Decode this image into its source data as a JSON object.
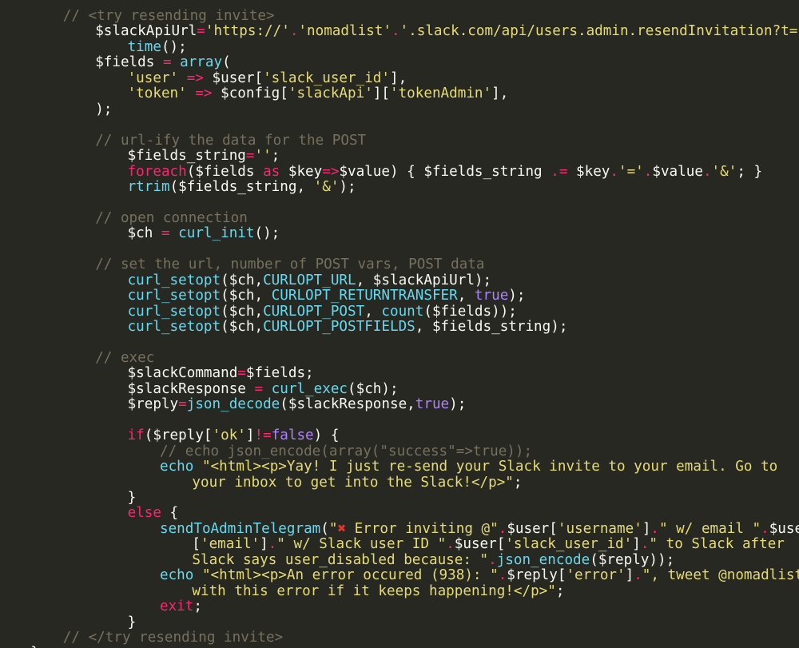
{
  "editor": {
    "theme": "dark",
    "colors": {
      "background": "#272822",
      "text": "#f8f8f2",
      "comment": "#75715e",
      "string": "#e6db74",
      "keyword": "#f92672",
      "function": "#66d9ef",
      "constant": "#ae81ff",
      "emoji": "#e8322d"
    },
    "lines": [
      {
        "indent": 2,
        "tokens": [
          [
            "c",
            "// <try resending invite>"
          ]
        ]
      },
      {
        "indent": 3,
        "tokens": [
          [
            "t",
            "$slackApiUrl"
          ],
          [
            "k",
            "="
          ],
          [
            "s",
            "'https://'"
          ],
          [
            "k",
            "."
          ],
          [
            "s",
            "'nomadlist'"
          ],
          [
            "k",
            "."
          ],
          [
            "s",
            "'.slack.com/api/users.admin.resendInvitation?t='"
          ],
          [
            "k",
            "."
          ]
        ]
      },
      {
        "indent": 4,
        "tokens": [
          [
            "f",
            "time"
          ],
          [
            "t",
            "();"
          ]
        ]
      },
      {
        "indent": 3,
        "tokens": [
          [
            "t",
            "$fields "
          ],
          [
            "k",
            "="
          ],
          [
            "t",
            " "
          ],
          [
            "f",
            "array"
          ],
          [
            "t",
            "("
          ]
        ]
      },
      {
        "indent": 4,
        "tokens": [
          [
            "s",
            "'user'"
          ],
          [
            "t",
            " "
          ],
          [
            "k",
            "=>"
          ],
          [
            "t",
            " $user["
          ],
          [
            "s",
            "'slack_user_id'"
          ],
          [
            "t",
            "],"
          ]
        ]
      },
      {
        "indent": 4,
        "tokens": [
          [
            "s",
            "'token'"
          ],
          [
            "t",
            " "
          ],
          [
            "k",
            "=>"
          ],
          [
            "t",
            " $config["
          ],
          [
            "s",
            "'slackApi'"
          ],
          [
            "t",
            "]["
          ],
          [
            "s",
            "'tokenAdmin'"
          ],
          [
            "t",
            "],"
          ]
        ]
      },
      {
        "indent": 3,
        "tokens": [
          [
            "t",
            ");"
          ]
        ]
      },
      {
        "indent": 0,
        "tokens": []
      },
      {
        "indent": 3,
        "tokens": [
          [
            "c",
            "// url-ify the data for the POST"
          ]
        ]
      },
      {
        "indent": 4,
        "tokens": [
          [
            "t",
            "$fields_string"
          ],
          [
            "k",
            "="
          ],
          [
            "s",
            "''"
          ],
          [
            "t",
            ";"
          ]
        ]
      },
      {
        "indent": 4,
        "tokens": [
          [
            "k",
            "foreach"
          ],
          [
            "t",
            "($fields "
          ],
          [
            "k",
            "as"
          ],
          [
            "t",
            " $key"
          ],
          [
            "k",
            "=>"
          ],
          [
            "t",
            "$value) { $fields_string "
          ],
          [
            "k",
            ".="
          ],
          [
            "t",
            " $key"
          ],
          [
            "k",
            "."
          ],
          [
            "s",
            "'='"
          ],
          [
            "k",
            "."
          ],
          [
            "t",
            "$value"
          ],
          [
            "k",
            "."
          ],
          [
            "s",
            "'&'"
          ],
          [
            "t",
            "; }"
          ]
        ]
      },
      {
        "indent": 4,
        "tokens": [
          [
            "f",
            "rtrim"
          ],
          [
            "t",
            "($fields_string, "
          ],
          [
            "s",
            "'&'"
          ],
          [
            "t",
            ");"
          ]
        ]
      },
      {
        "indent": 0,
        "tokens": []
      },
      {
        "indent": 3,
        "tokens": [
          [
            "c",
            "// open connection"
          ]
        ]
      },
      {
        "indent": 4,
        "tokens": [
          [
            "t",
            "$ch "
          ],
          [
            "k",
            "="
          ],
          [
            "t",
            " "
          ],
          [
            "f",
            "curl_init"
          ],
          [
            "t",
            "();"
          ]
        ]
      },
      {
        "indent": 0,
        "tokens": []
      },
      {
        "indent": 3,
        "tokens": [
          [
            "c",
            "// set the url, number of POST vars, POST data"
          ]
        ]
      },
      {
        "indent": 4,
        "tokens": [
          [
            "f",
            "curl_setopt"
          ],
          [
            "t",
            "($ch,"
          ],
          [
            "f",
            "CURLOPT_URL"
          ],
          [
            "t",
            ", $slackApiUrl);"
          ]
        ]
      },
      {
        "indent": 4,
        "tokens": [
          [
            "f",
            "curl_setopt"
          ],
          [
            "t",
            "($ch, "
          ],
          [
            "f",
            "CURLOPT_RETURNTRANSFER"
          ],
          [
            "t",
            ", "
          ],
          [
            "n",
            "true"
          ],
          [
            "t",
            ");"
          ]
        ]
      },
      {
        "indent": 4,
        "tokens": [
          [
            "f",
            "curl_setopt"
          ],
          [
            "t",
            "($ch,"
          ],
          [
            "f",
            "CURLOPT_POST"
          ],
          [
            "t",
            ", "
          ],
          [
            "f",
            "count"
          ],
          [
            "t",
            "($fields));"
          ]
        ]
      },
      {
        "indent": 4,
        "tokens": [
          [
            "f",
            "curl_setopt"
          ],
          [
            "t",
            "($ch,"
          ],
          [
            "f",
            "CURLOPT_POSTFIELDS"
          ],
          [
            "t",
            ", $fields_string);"
          ]
        ]
      },
      {
        "indent": 0,
        "tokens": []
      },
      {
        "indent": 3,
        "tokens": [
          [
            "c",
            "// exec"
          ]
        ]
      },
      {
        "indent": 4,
        "tokens": [
          [
            "t",
            "$slackCommand"
          ],
          [
            "k",
            "="
          ],
          [
            "t",
            "$fields;"
          ]
        ]
      },
      {
        "indent": 4,
        "tokens": [
          [
            "t",
            "$slackResponse "
          ],
          [
            "k",
            "="
          ],
          [
            "t",
            " "
          ],
          [
            "f",
            "curl_exec"
          ],
          [
            "t",
            "($ch);"
          ]
        ]
      },
      {
        "indent": 4,
        "tokens": [
          [
            "t",
            "$reply"
          ],
          [
            "k",
            "="
          ],
          [
            "f",
            "json_decode"
          ],
          [
            "t",
            "($slackResponse,"
          ],
          [
            "n",
            "true"
          ],
          [
            "t",
            ");"
          ]
        ]
      },
      {
        "indent": 0,
        "tokens": []
      },
      {
        "indent": 4,
        "tokens": [
          [
            "k",
            "if"
          ],
          [
            "t",
            "($reply["
          ],
          [
            "s",
            "'ok'"
          ],
          [
            "t",
            "]"
          ],
          [
            "k",
            "!="
          ],
          [
            "n",
            "false"
          ],
          [
            "t",
            ") {"
          ]
        ]
      },
      {
        "indent": 5,
        "tokens": [
          [
            "c",
            "// echo json_encode(array(\"success\"=>true));"
          ]
        ]
      },
      {
        "indent": 5,
        "tokens": [
          [
            "f",
            "echo"
          ],
          [
            "t",
            " "
          ],
          [
            "s",
            "\"<html><p>Yay! I just re-send your Slack invite to your email. Go to"
          ]
        ]
      },
      {
        "indent": 6,
        "tokens": [
          [
            "s",
            "your inbox to get into the Slack!</p>\""
          ],
          [
            "t",
            ";"
          ]
        ]
      },
      {
        "indent": 4,
        "tokens": [
          [
            "t",
            "}"
          ]
        ]
      },
      {
        "indent": 4,
        "tokens": [
          [
            "k",
            "else"
          ],
          [
            "t",
            " {"
          ]
        ]
      },
      {
        "indent": 5,
        "tokens": [
          [
            "f",
            "sendToAdminTelegram"
          ],
          [
            "t",
            "("
          ],
          [
            "s",
            "\""
          ],
          [
            "x",
            "✖"
          ],
          [
            "s",
            " Error inviting @\""
          ],
          [
            "k",
            "."
          ],
          [
            "t",
            "$user["
          ],
          [
            "s",
            "'username'"
          ],
          [
            "t",
            "]"
          ],
          [
            "k",
            "."
          ],
          [
            "s",
            "\" w/ email \""
          ],
          [
            "k",
            "."
          ],
          [
            "t",
            "$user"
          ]
        ]
      },
      {
        "indent": 6,
        "tokens": [
          [
            "t",
            "["
          ],
          [
            "s",
            "'email'"
          ],
          [
            "t",
            "]"
          ],
          [
            "k",
            "."
          ],
          [
            "s",
            "\" w/ Slack user ID \""
          ],
          [
            "k",
            "."
          ],
          [
            "t",
            "$user["
          ],
          [
            "s",
            "'slack_user_id'"
          ],
          [
            "t",
            "]"
          ],
          [
            "k",
            "."
          ],
          [
            "s",
            "\" to Slack after"
          ]
        ]
      },
      {
        "indent": 6,
        "tokens": [
          [
            "s",
            "Slack says user_disabled because: \""
          ],
          [
            "k",
            "."
          ],
          [
            "f",
            "json_encode"
          ],
          [
            "t",
            "($reply));"
          ]
        ]
      },
      {
        "indent": 5,
        "tokens": [
          [
            "f",
            "echo"
          ],
          [
            "t",
            " "
          ],
          [
            "s",
            "\"<html><p>An error occured (938): \""
          ],
          [
            "k",
            "."
          ],
          [
            "t",
            "$reply["
          ],
          [
            "s",
            "'error'"
          ],
          [
            "t",
            "]"
          ],
          [
            "k",
            "."
          ],
          [
            "s",
            "\", tweet @nomadlist"
          ]
        ]
      },
      {
        "indent": 6,
        "tokens": [
          [
            "s",
            "with this error if it keeps happening!</p>\""
          ],
          [
            "t",
            ";"
          ]
        ]
      },
      {
        "indent": 5,
        "tokens": [
          [
            "k",
            "exit"
          ],
          [
            "t",
            ";"
          ]
        ]
      },
      {
        "indent": 4,
        "tokens": [
          [
            "t",
            "}"
          ]
        ]
      },
      {
        "indent": 2,
        "tokens": [
          [
            "c",
            "// </try resending invite>"
          ]
        ]
      },
      {
        "indent": 1,
        "tokens": [
          [
            "t",
            "}"
          ]
        ]
      }
    ]
  }
}
